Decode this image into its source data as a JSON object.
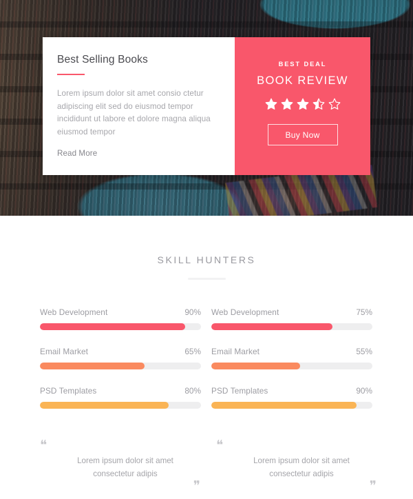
{
  "theme": {
    "accent": "#f9576b",
    "orange": "#fa8a5f",
    "amber": "#fab455",
    "track": "#eeeeef",
    "muted_text": "#9c9ca2"
  },
  "hero": {
    "card": {
      "title": "Best Selling Books",
      "body": "Lorem ipsum dolor sit amet consio ctetur adipiscing elit sed do eiusmod tempor incididunt ut labore et dolore magna aliqua eiusmod tempor",
      "read_more_label": "Read More"
    },
    "deal": {
      "kicker": "BEST DEAL",
      "title": "BOOK REVIEW",
      "rating": 3.5,
      "rating_max": 5,
      "buy_label": "Buy Now"
    }
  },
  "skills_section": {
    "title": "SKILL HUNTERS",
    "columns": [
      {
        "skills": [
          {
            "name": "Web Development",
            "percent_label": "90%",
            "percent": 90,
            "color": "#f9576b"
          },
          {
            "name": "Email Market",
            "percent_label": "65%",
            "percent": 65,
            "color": "#fa8a5f"
          },
          {
            "name": "PSD Templates",
            "percent_label": "80%",
            "percent": 80,
            "color": "#fab455"
          }
        ]
      },
      {
        "skills": [
          {
            "name": "Web Development",
            "percent_label": "75%",
            "percent": 75,
            "color": "#f9576b"
          },
          {
            "name": "Email Market",
            "percent_label": "55%",
            "percent": 55,
            "color": "#fa8a5f"
          },
          {
            "name": "PSD Templates",
            "percent_label": "90%",
            "percent": 90,
            "color": "#fab455"
          }
        ]
      }
    ]
  },
  "testimonials": [
    {
      "open_mark": "❝",
      "text": "Lorem ipsum dolor sit amet consectetur adipis",
      "close_mark": "❞"
    },
    {
      "open_mark": "❝",
      "text": "Lorem ipsum dolor sit amet consectetur adipis",
      "close_mark": "❞"
    }
  ]
}
